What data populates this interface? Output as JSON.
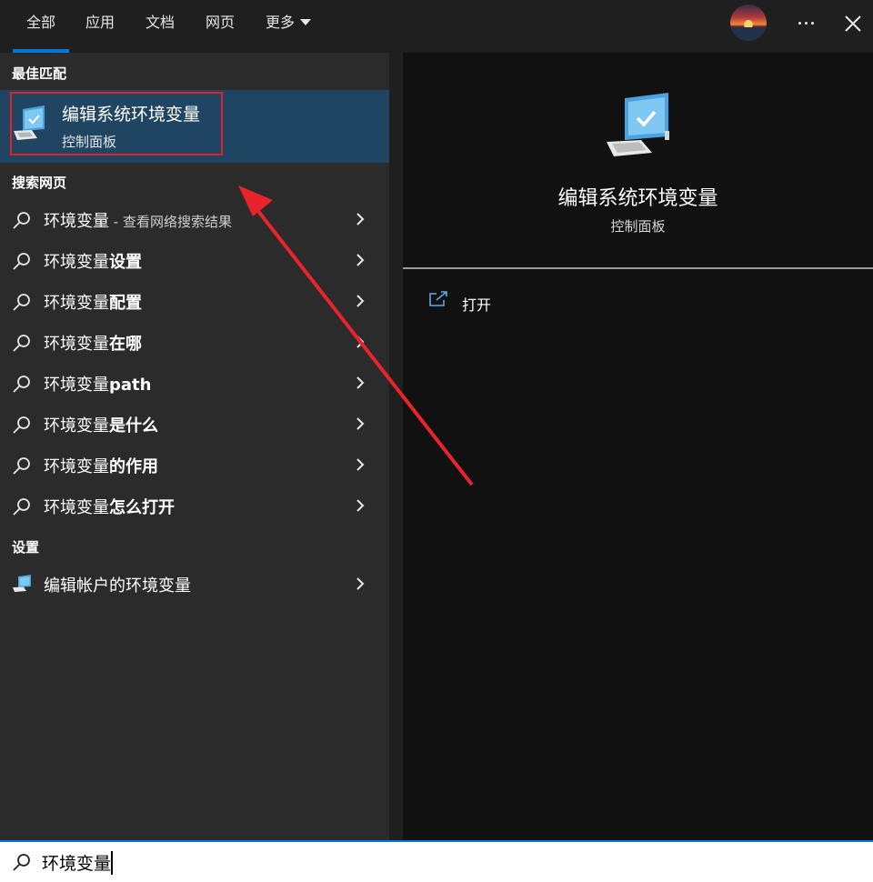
{
  "tabs": {
    "all": "全部",
    "apps": "应用",
    "docs": "文档",
    "web": "网页",
    "more": "更多"
  },
  "sections": {
    "best_match": "最佳匹配",
    "search_web": "搜索网页",
    "settings": "设置"
  },
  "best_match": {
    "title": "编辑系统环境变量",
    "subtitle": "控制面板"
  },
  "web_results": [
    {
      "prefix": "环境变量",
      "bold": "",
      "suffix": " - 查看网络搜索结果"
    },
    {
      "prefix": "环境变量",
      "bold": "设置",
      "suffix": ""
    },
    {
      "prefix": "环境变量",
      "bold": "配置",
      "suffix": ""
    },
    {
      "prefix": "环境变量",
      "bold": "在哪",
      "suffix": ""
    },
    {
      "prefix": "环境变量",
      "bold": "path",
      "suffix": ""
    },
    {
      "prefix": "环境变量",
      "bold": "是什么",
      "suffix": ""
    },
    {
      "prefix": "环境变量",
      "bold": "的作用",
      "suffix": ""
    },
    {
      "prefix": "环境变量",
      "bold": "怎么打开",
      "suffix": ""
    }
  ],
  "settings_results": [
    {
      "label": "编辑帐户的环境变量"
    }
  ],
  "detail": {
    "title": "编辑系统环境变量",
    "subtitle": "控制面板",
    "actions": [
      {
        "label": "打开"
      }
    ]
  },
  "search": {
    "value": "环境变量"
  },
  "colors": {
    "accent": "#0078d7",
    "selected_bg": "#204562",
    "highlight_box": "#e0202a",
    "annotation_arrow": "#e8232b"
  }
}
